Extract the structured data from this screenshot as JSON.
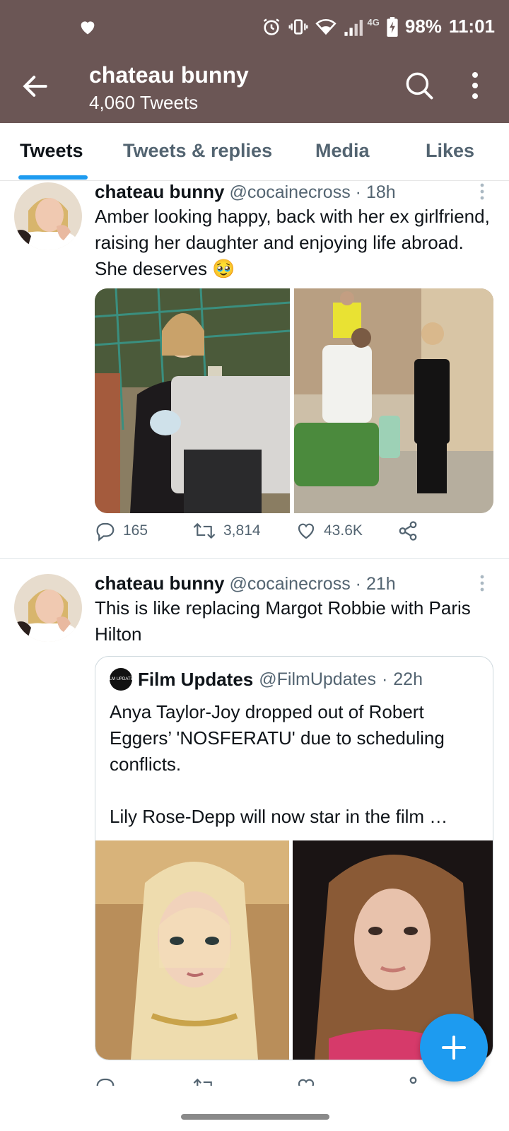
{
  "status_bar": {
    "network": "4G",
    "battery": "98%",
    "time": "11:01"
  },
  "header": {
    "title": "chateau bunny",
    "subtitle": "4,060 Tweets"
  },
  "tabs": [
    {
      "label": "Tweets",
      "active": true
    },
    {
      "label": "Tweets & replies",
      "active": false
    },
    {
      "label": "Media",
      "active": false
    },
    {
      "label": "Likes",
      "active": false
    }
  ],
  "tweets": [
    {
      "name": "chateau bunny",
      "handle": "@cocainecross",
      "time": "18h",
      "text": "Amber looking happy, back with her ex girlfriend, raising her daughter and enjoying life abroad. She deserves 🥹",
      "replies": "165",
      "retweets": "3,814",
      "likes": "43.6K"
    },
    {
      "name": "chateau bunny",
      "handle": "@cocainecross",
      "time": "21h",
      "text": "This is like replacing Margot Robbie with Paris Hilton",
      "quote": {
        "name": "Film Updates",
        "handle": "@FilmUpdates",
        "time": "22h",
        "logo_text": "FILM UPDATES",
        "text": "Anya Taylor-Joy dropped out of Robert Eggers’ 'NOSFERATU' due to scheduling conflicts.\n\nLily Rose-Depp will now star in the film …"
      }
    }
  ],
  "colors": {
    "header_bg": "#6b5655",
    "accent": "#1d9bf0",
    "secondary_text": "#536471"
  }
}
